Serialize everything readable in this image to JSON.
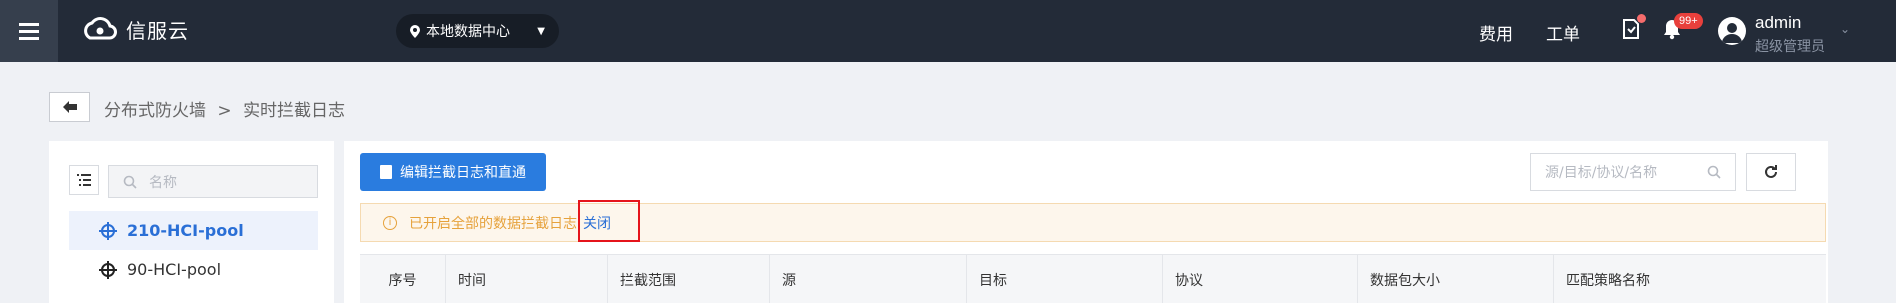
{
  "header": {
    "brand": "信服云",
    "datacenter": "本地数据中心",
    "links": {
      "cost": "费用",
      "ticket": "工单"
    },
    "notification_count": "99+",
    "user": {
      "name": "admin",
      "role": "超级管理员"
    }
  },
  "breadcrumb": {
    "parent": "分布式防火墙",
    "separator": ">",
    "current": "实时拦截日志"
  },
  "left_panel": {
    "search_placeholder": "名称",
    "pools": [
      {
        "label": "210-HCI-pool",
        "selected": true
      },
      {
        "label": "90-HCI-pool",
        "selected": false
      }
    ]
  },
  "main": {
    "edit_button": "编辑拦截日志和直通",
    "search_placeholder": "源/目标/协议/名称",
    "notice": {
      "text": "已开启全部的数据拦截日志",
      "action": "关闭"
    },
    "table": {
      "columns": [
        "序号",
        "时间",
        "拦截范围",
        "源",
        "目标",
        "协议",
        "数据包大小",
        "匹配策略名称"
      ]
    }
  },
  "colors": {
    "topbar": "#232b38",
    "accent": "#2a7cdf",
    "warning": "#e6a23c",
    "highlight": "#e5141b"
  }
}
